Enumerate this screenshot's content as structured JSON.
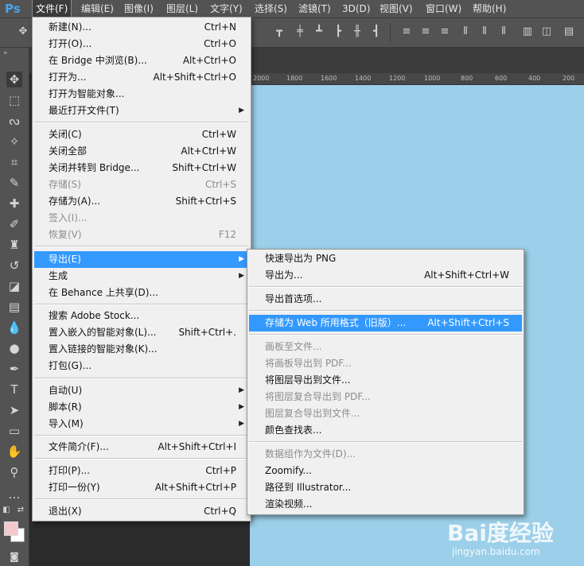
{
  "app": {
    "logo": "Ps"
  },
  "menubar": {
    "items": [
      "文件(F)",
      "编辑(E)",
      "图像(I)",
      "图层(L)",
      "文字(Y)",
      "选择(S)",
      "滤镜(T)",
      "3D(D)",
      "视图(V)",
      "窗口(W)",
      "帮助(H)"
    ]
  },
  "ruler": {
    "ticks": [
      "2000",
      "1800",
      "1600",
      "1400",
      "1200",
      "1000",
      "800",
      "600",
      "400",
      "200"
    ]
  },
  "file_menu": {
    "items": [
      {
        "label": "新建(N)...",
        "shortcut": "Ctrl+N"
      },
      {
        "label": "打开(O)...",
        "shortcut": "Ctrl+O"
      },
      {
        "label": "在 Bridge 中浏览(B)...",
        "shortcut": "Alt+Ctrl+O"
      },
      {
        "label": "打开为...",
        "shortcut": "Alt+Shift+Ctrl+O"
      },
      {
        "label": "打开为智能对象...",
        "shortcut": ""
      },
      {
        "label": "最近打开文件(T)",
        "shortcut": ""
      },
      {
        "label": "关闭(C)",
        "shortcut": "Ctrl+W"
      },
      {
        "label": "关闭全部",
        "shortcut": "Alt+Ctrl+W"
      },
      {
        "label": "关闭并转到 Bridge...",
        "shortcut": "Shift+Ctrl+W"
      },
      {
        "label": "存储(S)",
        "shortcut": "Ctrl+S"
      },
      {
        "label": "存储为(A)...",
        "shortcut": "Shift+Ctrl+S"
      },
      {
        "label": "签入(I)...",
        "shortcut": ""
      },
      {
        "label": "恢复(V)",
        "shortcut": "F12"
      },
      {
        "label": "导出(E)",
        "shortcut": ""
      },
      {
        "label": "生成",
        "shortcut": ""
      },
      {
        "label": "在 Behance 上共享(D)...",
        "shortcut": ""
      },
      {
        "label": "搜索 Adobe Stock...",
        "shortcut": ""
      },
      {
        "label": "置入嵌入的智能对象(L)...",
        "shortcut": "Shift+Ctrl+."
      },
      {
        "label": "置入链接的智能对象(K)...",
        "shortcut": ""
      },
      {
        "label": "打包(G)...",
        "shortcut": ""
      },
      {
        "label": "自动(U)",
        "shortcut": ""
      },
      {
        "label": "脚本(R)",
        "shortcut": ""
      },
      {
        "label": "导入(M)",
        "shortcut": ""
      },
      {
        "label": "文件简介(F)...",
        "shortcut": "Alt+Shift+Ctrl+I"
      },
      {
        "label": "打印(P)...",
        "shortcut": "Ctrl+P"
      },
      {
        "label": "打印一份(Y)",
        "shortcut": "Alt+Shift+Ctrl+P"
      },
      {
        "label": "退出(X)",
        "shortcut": "Ctrl+Q"
      }
    ]
  },
  "export_menu": {
    "items": [
      {
        "label": "快速导出为 PNG",
        "shortcut": ""
      },
      {
        "label": "导出为...",
        "shortcut": "Alt+Shift+Ctrl+W"
      },
      {
        "label": "导出首选项...",
        "shortcut": ""
      },
      {
        "label": "存储为 Web 所用格式（旧版）...",
        "shortcut": "Alt+Shift+Ctrl+S"
      },
      {
        "label": "画板至文件...",
        "shortcut": ""
      },
      {
        "label": "将画板导出到 PDF...",
        "shortcut": ""
      },
      {
        "label": "将图层导出到文件...",
        "shortcut": ""
      },
      {
        "label": "将图层复合导出到 PDF...",
        "shortcut": ""
      },
      {
        "label": "图层复合导出到文件...",
        "shortcut": ""
      },
      {
        "label": "颜色查找表...",
        "shortcut": ""
      },
      {
        "label": "数据组作为文件(D)...",
        "shortcut": ""
      },
      {
        "label": "Zoomify...",
        "shortcut": ""
      },
      {
        "label": "路径到 Illustrator...",
        "shortcut": ""
      },
      {
        "label": "渲染视频...",
        "shortcut": ""
      }
    ]
  },
  "colors": {
    "highlight": "#3399ff",
    "canvas": "#9ccfe9",
    "foreground_swatch": "#f2c8cc",
    "background_swatch": "#ffffff"
  },
  "watermark": {
    "brand": "Bai度经验",
    "site": "jingyan.baidu.com"
  }
}
